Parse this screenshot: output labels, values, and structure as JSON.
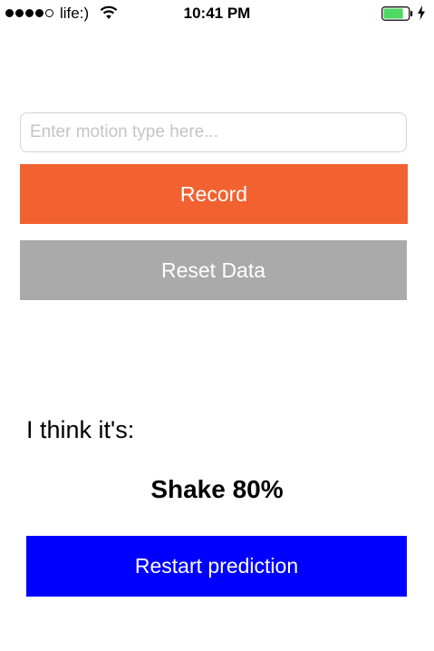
{
  "status_bar": {
    "signal_bars_filled": 4,
    "signal_bars_total": 5,
    "carrier": "life:)",
    "time": "10:41 PM",
    "battery_level": 0.8,
    "charging": true,
    "battery_color": "#4cd964"
  },
  "motion_input": {
    "value": "",
    "placeholder": "Enter motion type here..."
  },
  "buttons": {
    "record_label": "Record",
    "record_color": "#f26230",
    "reset_label": "Reset Data",
    "reset_color": "#aaaaaa",
    "restart_label": "Restart prediction",
    "restart_color": "#0000ff"
  },
  "prediction": {
    "label": "I think it's:",
    "result": "Shake 80%"
  },
  "icons": {
    "wifi": "wifi-icon",
    "battery": "battery-icon",
    "charging": "charging-bolt-icon"
  }
}
